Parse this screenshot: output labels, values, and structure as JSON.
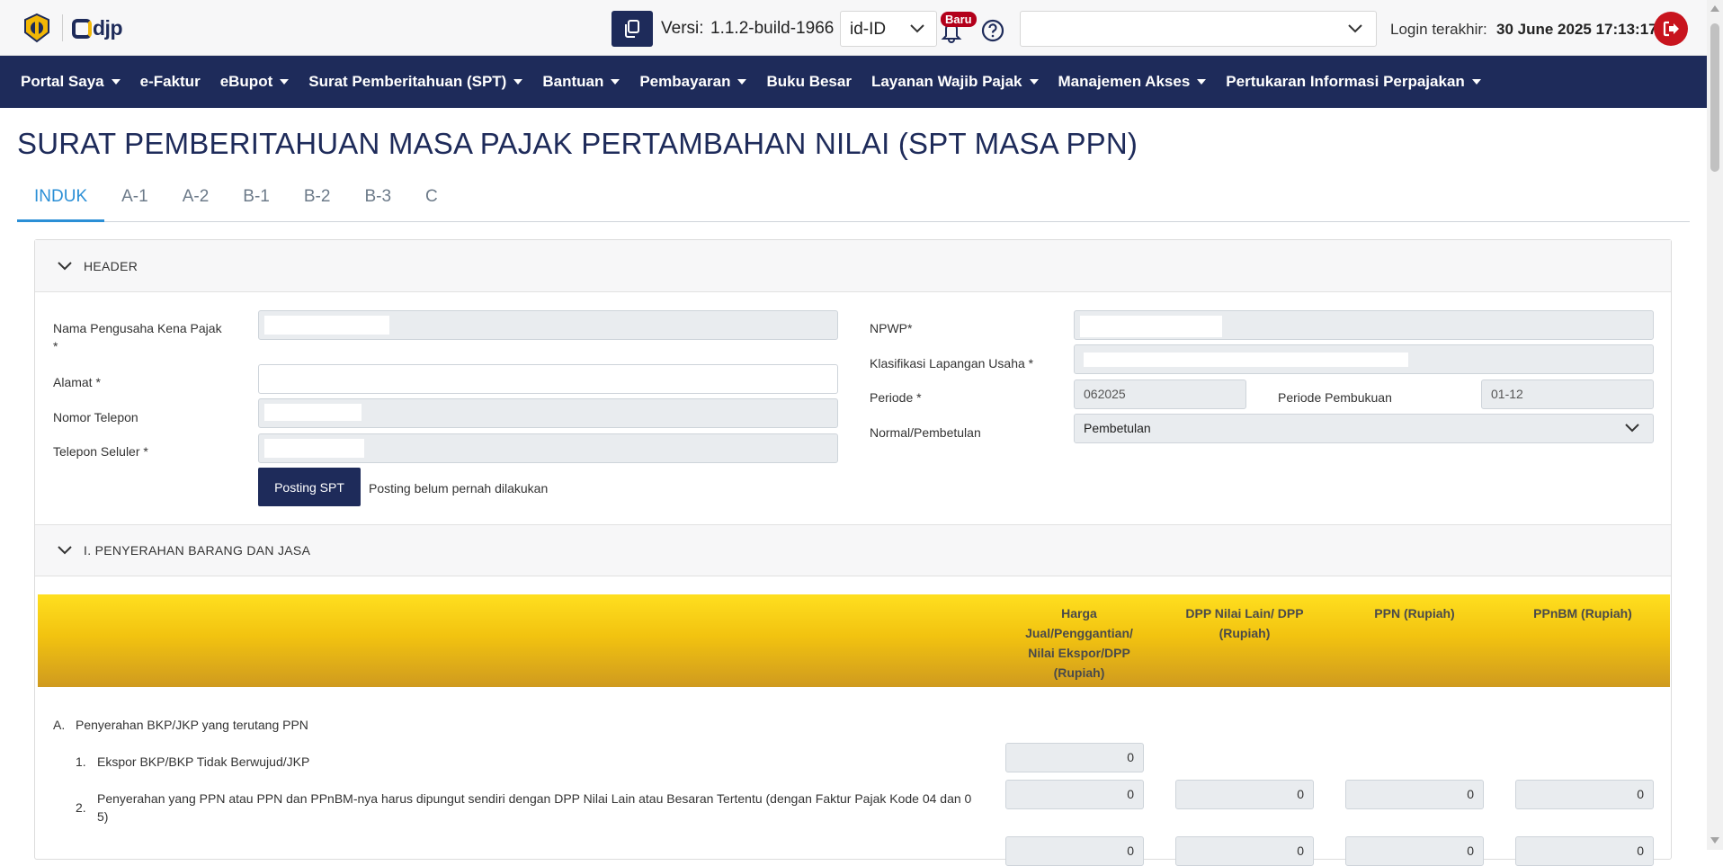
{
  "topbar": {
    "logo_text": "djp",
    "version_label": "Versi:",
    "version_value": "1.1.2-build-1966",
    "language": "id-ID",
    "badge_new": "Baru",
    "login_label": "Login terakhir:",
    "login_value": "30 June 2025 17:13:17"
  },
  "nav": {
    "items": [
      {
        "label": "Portal Saya",
        "dropdown": true
      },
      {
        "label": "e-Faktur",
        "dropdown": false
      },
      {
        "label": "eBupot",
        "dropdown": true
      },
      {
        "label": "Surat Pemberitahuan (SPT)",
        "dropdown": true
      },
      {
        "label": "Bantuan",
        "dropdown": true
      },
      {
        "label": "Pembayaran",
        "dropdown": true
      },
      {
        "label": "Buku Besar",
        "dropdown": false
      },
      {
        "label": "Layanan Wajib Pajak",
        "dropdown": true
      },
      {
        "label": "Manajemen Akses",
        "dropdown": true
      },
      {
        "label": "Pertukaran Informasi Perpajakan",
        "dropdown": true
      }
    ]
  },
  "page": {
    "title": "SURAT PEMBERITAHUAN MASA PAJAK PERTAMBAHAN NILAI (SPT MASA PPN)",
    "tabs": [
      "INDUK",
      "A-1",
      "A-2",
      "B-1",
      "B-2",
      "B-3",
      "C"
    ],
    "active_tab": "INDUK"
  },
  "header_section": {
    "title": "HEADER",
    "nama_label": "Nama Pengusaha Kena Pajak",
    "nama_required": "*",
    "alamat_label": "Alamat *",
    "telepon_label": "Nomor Telepon",
    "seluler_label": "Telepon Seluler *",
    "npwp_label": "NPWP*",
    "klu_label": "Klasifikasi Lapangan Usaha *",
    "periode_label": "Periode *",
    "periode_value": "062025",
    "pembukuan_label": "Periode Pembukuan",
    "pembukuan_value": "01-12",
    "normal_label": "Normal/Pembetulan",
    "normal_value": "Pembetulan",
    "posting_button": "Posting SPT",
    "posting_status": "Posting belum pernah dilakukan"
  },
  "section1": {
    "title": "I. PENYERAHAN BARANG DAN JASA",
    "columns": [
      "Harga Jual/Penggantian/ Nilai Ekspor/DPP (Rupiah)",
      "DPP Nilai Lain/ DPP (Rupiah)",
      "PPN (Rupiah)",
      "PPnBM (Rupiah)"
    ],
    "group_a_marker": "A.",
    "group_a_label": "Penyerahan BKP/JKP yang terutang PPN",
    "rows": [
      {
        "num": "1.",
        "label": "Ekspor BKP/BKP Tidak Berwujud/JKP",
        "values": [
          "0"
        ]
      },
      {
        "num": "2.",
        "label_line1": "Penyerahan yang PPN atau PPN dan PPnBM-nya harus dipungut sendiri dengan DPP Nilai Lain atau Besaran Tertentu (dengan Faktur Pajak Kode 04 dan 0",
        "label_line2": "5)",
        "values": [
          "0",
          "0",
          "0",
          "0"
        ]
      },
      {
        "num": "",
        "values": [
          "0",
          "0",
          "0",
          "0"
        ]
      }
    ]
  }
}
